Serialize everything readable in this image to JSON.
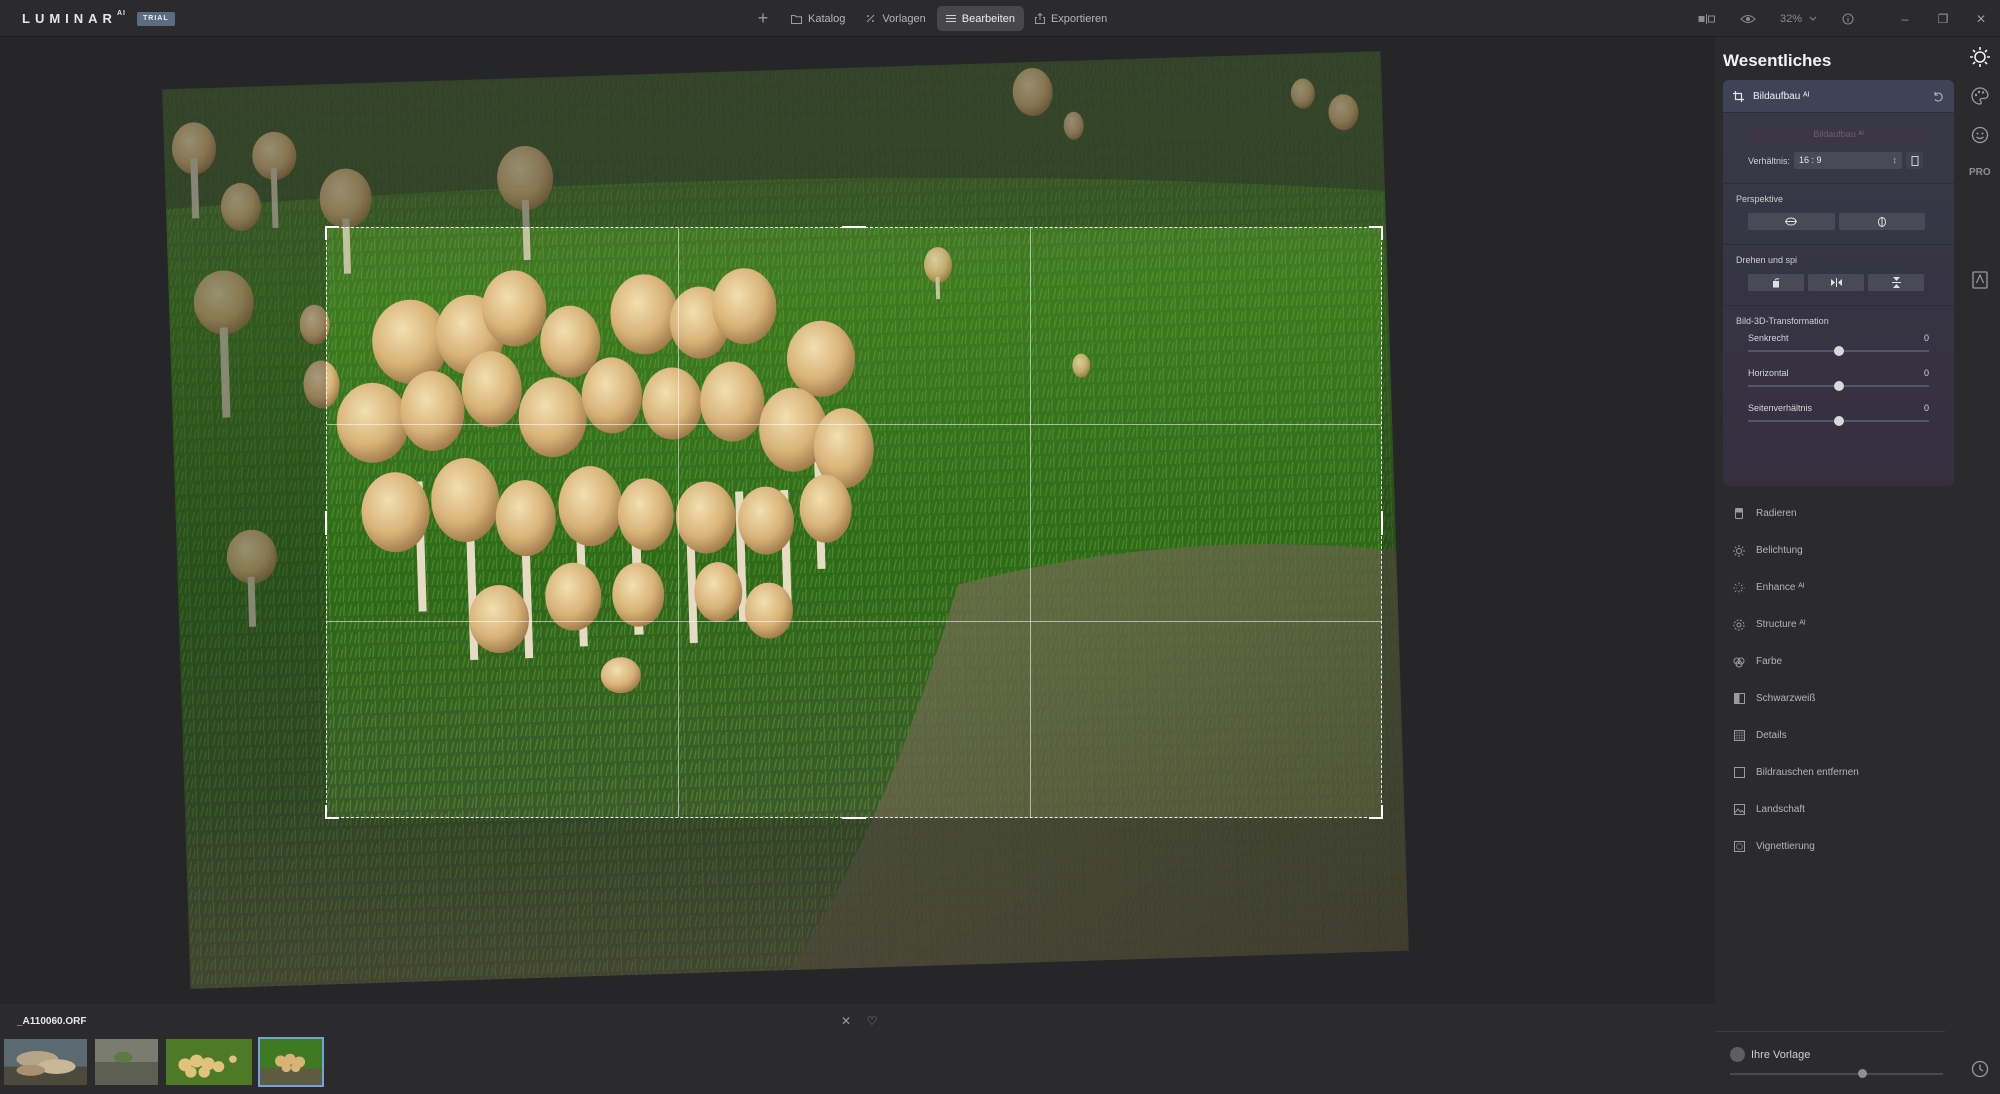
{
  "app": {
    "logo": "LUMINAR",
    "logo_sup": "AI",
    "badge": "TRIAL"
  },
  "nav": {
    "add_label": "+",
    "items": [
      {
        "label": "Katalog",
        "icon": "folder-icon"
      },
      {
        "label": "Vorlagen",
        "icon": "sparkle-icon"
      },
      {
        "label": "Bearbeiten",
        "icon": "sliders-icon",
        "active": true
      },
      {
        "label": "Exportieren",
        "icon": "share-icon"
      }
    ]
  },
  "topright": {
    "zoom": "32%",
    "compare_icon": "compare-icon",
    "preview_icon": "eye-icon",
    "info_icon": "info-icon"
  },
  "window": {
    "minimize": "–",
    "maximize": "❐",
    "close": "✕"
  },
  "filmstrip": {
    "filename": "_A110060.ORF",
    "reject_label": "✕",
    "favorite_label": "♡",
    "thumbs": 4,
    "selected_index": 3
  },
  "panel": {
    "title": "Wesentliches",
    "card": {
      "title": "Bildaufbau ᴬᴵ",
      "ai_button": "Bildaufbau ᴬᴵ",
      "ratio_label": "Verhältnis:",
      "ratio_value": "16 : 9",
      "perspective_title": "Perspektive",
      "rotate_title": "Drehen und spi­",
      "transform_title": "Bild-3D-Transformation",
      "sliders": [
        {
          "label": "Senkrecht",
          "value": "0",
          "position": 0.5
        },
        {
          "label": "Horizontal",
          "value": "0",
          "position": 0.5
        },
        {
          "label": "Seitenverhältnis",
          "value": "0",
          "position": 0.5
        }
      ]
    },
    "tools": [
      {
        "label": "Radieren",
        "icon": "eraser-icon"
      },
      {
        "label": "Belichtung",
        "icon": "sun-icon"
      },
      {
        "label": "Enhance ᴬᴵ",
        "icon": "enhance-icon"
      },
      {
        "label": "Structure ᴬᴵ",
        "icon": "structure-icon"
      },
      {
        "label": "Farbe",
        "icon": "palette-icon"
      },
      {
        "label": "Schwarzweiß",
        "icon": "bw-icon"
      },
      {
        "label": "Details",
        "icon": "details-icon"
      },
      {
        "label": "Bildrauschen entfernen",
        "icon": "denoise-icon"
      },
      {
        "label": "Landschaft",
        "icon": "landscape-icon"
      },
      {
        "label": "Vignettierung",
        "icon": "vignette-icon"
      }
    ],
    "preset_label": "Ihre Vorlage",
    "preset_amount": 0.62
  },
  "sidestrip": {
    "pro_label": "PRO"
  },
  "colors": {
    "background": "#2b2b2d",
    "accent_selected": "#6fa4dd",
    "card": "#383a48",
    "active_nav": "#48484c"
  }
}
